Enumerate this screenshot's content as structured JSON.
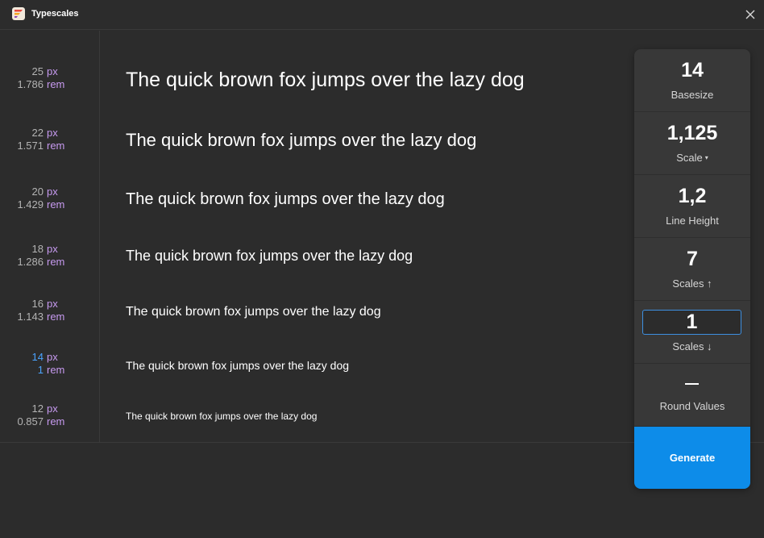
{
  "app": {
    "title": "Typescales",
    "logo_icon": "typescales-logo-icon",
    "close_icon": "close-icon"
  },
  "scale_rows": [
    {
      "px": "25",
      "px_unit": "px",
      "rem": "1.786",
      "rem_unit": "rem",
      "sample": "The quick brown fox jumps over the lazy dog",
      "is_base": false
    },
    {
      "px": "22",
      "px_unit": "px",
      "rem": "1.571",
      "rem_unit": "rem",
      "sample": "The quick brown fox jumps over the lazy dog",
      "is_base": false
    },
    {
      "px": "20",
      "px_unit": "px",
      "rem": "1.429",
      "rem_unit": "rem",
      "sample": "The quick brown fox jumps over the lazy dog",
      "is_base": false
    },
    {
      "px": "18",
      "px_unit": "px",
      "rem": "1.286",
      "rem_unit": "rem",
      "sample": "The quick brown fox jumps over the lazy dog",
      "is_base": false
    },
    {
      "px": "16",
      "px_unit": "px",
      "rem": "1.143",
      "rem_unit": "rem",
      "sample": "The quick brown fox jumps over the lazy dog",
      "is_base": false
    },
    {
      "px": "14",
      "px_unit": "px",
      "rem": "1",
      "rem_unit": "rem",
      "sample": "The quick brown fox jumps over the lazy dog",
      "is_base": true
    },
    {
      "px": "12",
      "px_unit": "px",
      "rem": "0.857",
      "rem_unit": "rem",
      "sample": "The quick brown fox jumps over the lazy dog",
      "is_base": false
    }
  ],
  "settings": {
    "basesize": {
      "value": "14",
      "label": "Basesize"
    },
    "scale": {
      "value": "1,125",
      "label": "Scale",
      "caret": "▾"
    },
    "line_height": {
      "value": "1,2",
      "label": "Line Height"
    },
    "scales_up": {
      "value": "7",
      "label": "Scales ↑"
    },
    "scales_down": {
      "value": "1",
      "label": "Scales ↓"
    },
    "round_values": {
      "label": "Round Values"
    },
    "generate_label": "Generate"
  },
  "colors": {
    "background": "#2c2c2c",
    "panel": "#383838",
    "accent_blue": "#0d8ce9",
    "unit_purple": "#c79af0",
    "base_blue": "#4aa3ff"
  }
}
